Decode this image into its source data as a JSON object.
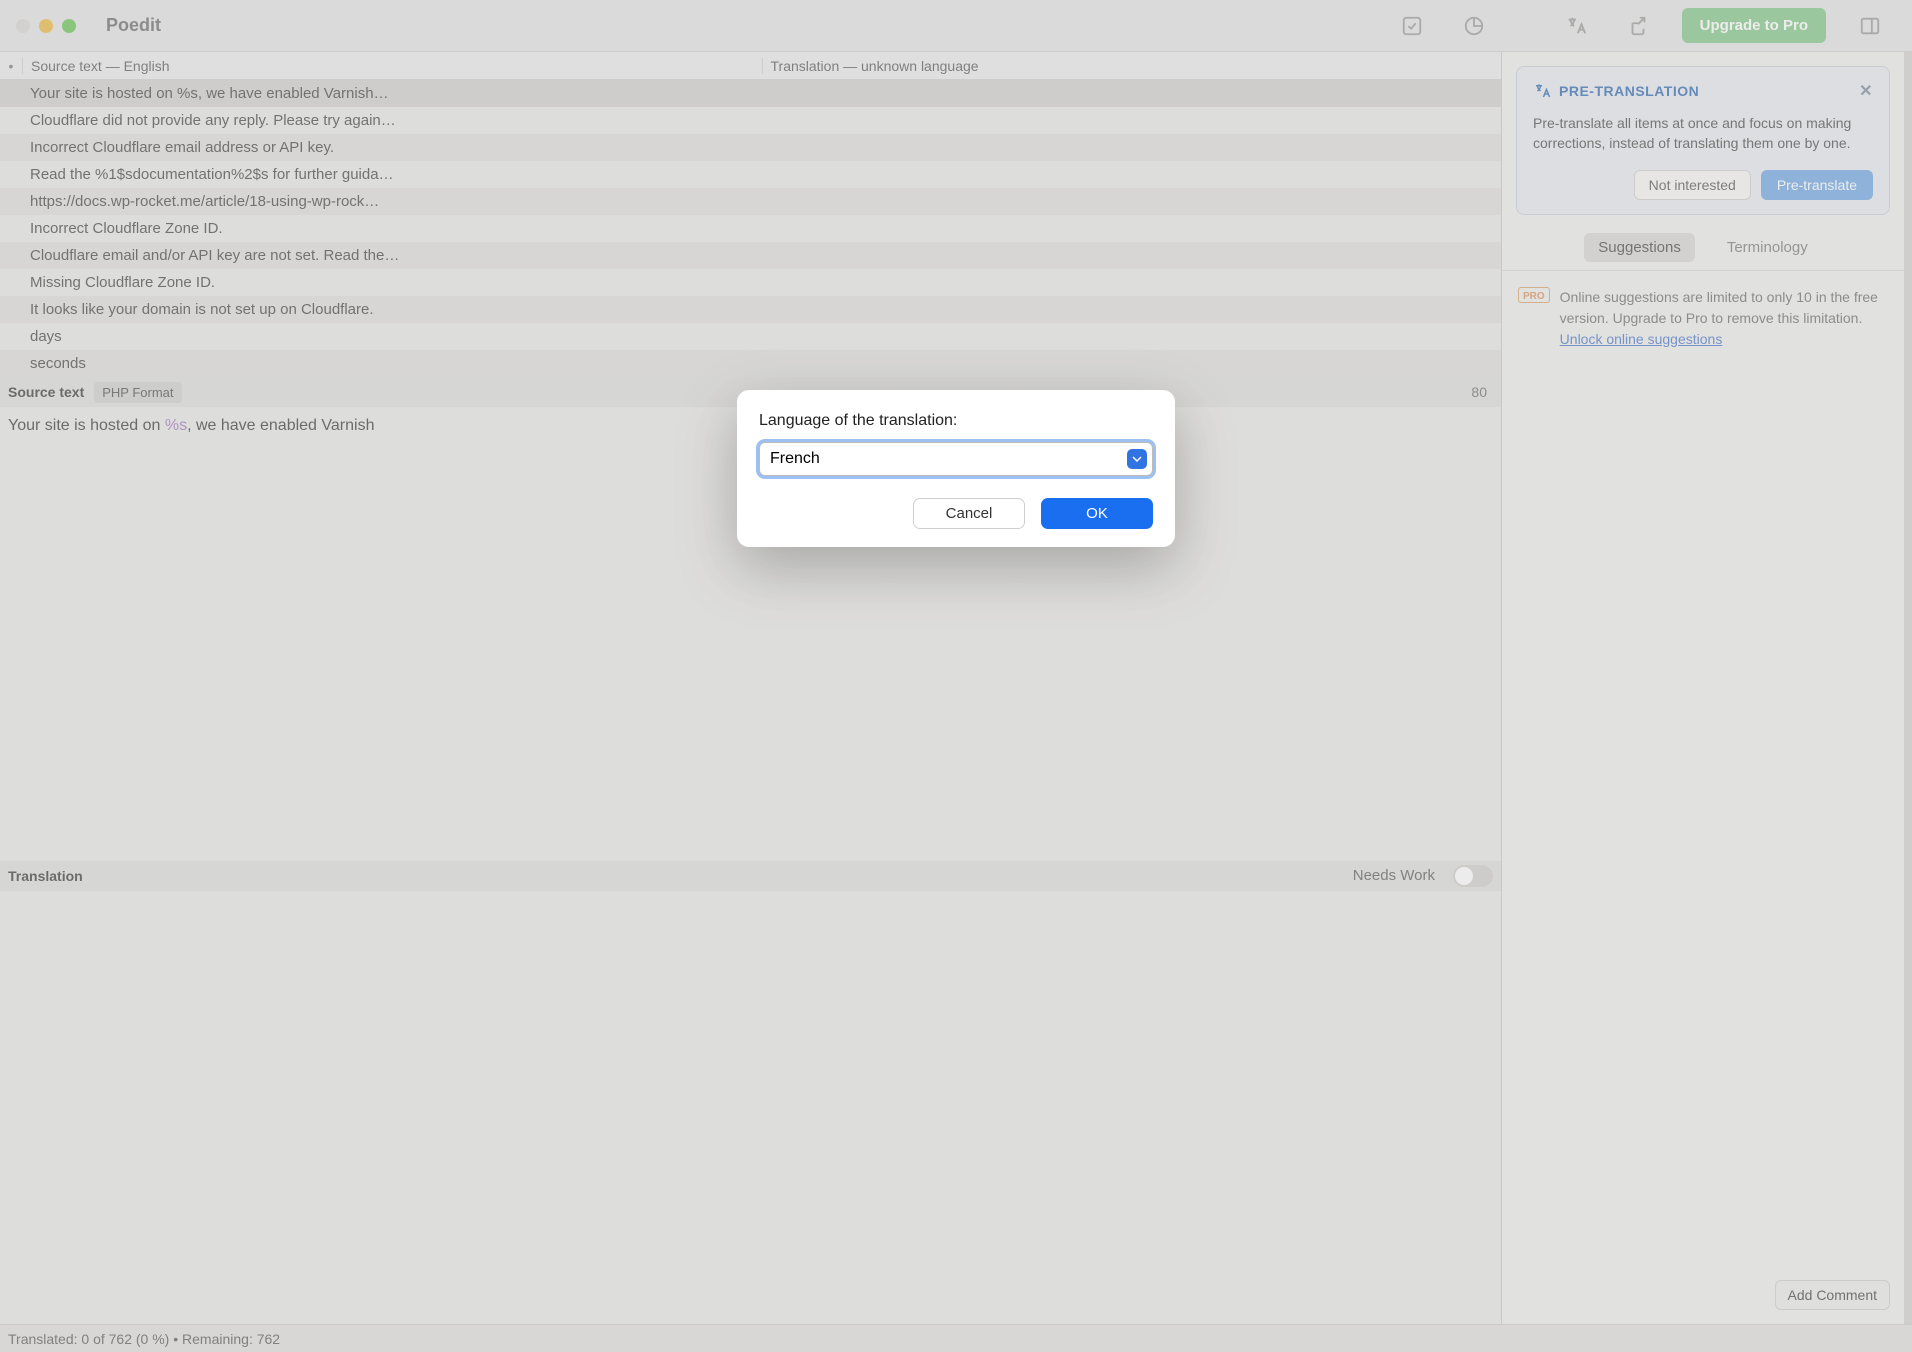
{
  "app_title": "Poedit",
  "toolbar": {
    "upgrade_label": "Upgrade to Pro"
  },
  "table": {
    "source_header": "Source text — English",
    "translation_header": "Translation — unknown language",
    "rows": [
      "Your site is hosted on %s, we have enabled Varnish…",
      "Cloudflare did not provide any reply. Please try again…",
      "Incorrect Cloudflare email address or API key.",
      "Read the %1$sdocumentation%2$s for further guida…",
      "https://docs.wp-rocket.me/article/18-using-wp-rock…",
      "Incorrect Cloudflare Zone ID.",
      "Cloudflare email and/or API key are not set. Read the…",
      "Missing Cloudflare Zone ID.",
      "It looks like your domain is not set up on Cloudflare.",
      "days",
      "seconds"
    ]
  },
  "source_section": {
    "label": "Source text",
    "format_tag": "PHP Format",
    "counter": "80",
    "text_before": "Your site is hosted on ",
    "placeholder": "%s",
    "text_after": ", we have enabled Varnish"
  },
  "translation_section": {
    "label": "Translation",
    "needs_work_label": "Needs Work"
  },
  "sidebar": {
    "pretrans": {
      "title": "PRE-TRANSLATION",
      "desc": "Pre-translate all items at once and focus on making corrections, instead of translating them one by one.",
      "not_interested": "Not interested",
      "pretranslate": "Pre-translate"
    },
    "tabs": {
      "suggestions": "Suggestions",
      "terminology": "Terminology"
    },
    "pro_note": "Online suggestions are limited to only 10 in the free version. Upgrade to Pro to remove this limitation.",
    "pro_link": "Unlock online suggestions",
    "pro_badge": "PRO",
    "add_comment": "Add Comment"
  },
  "statusbar": {
    "text": "Translated: 0 of 762 (0 %)   •   Remaining: 762"
  },
  "modal": {
    "label": "Language of the translation:",
    "value": "French",
    "cancel": "Cancel",
    "ok": "OK"
  }
}
